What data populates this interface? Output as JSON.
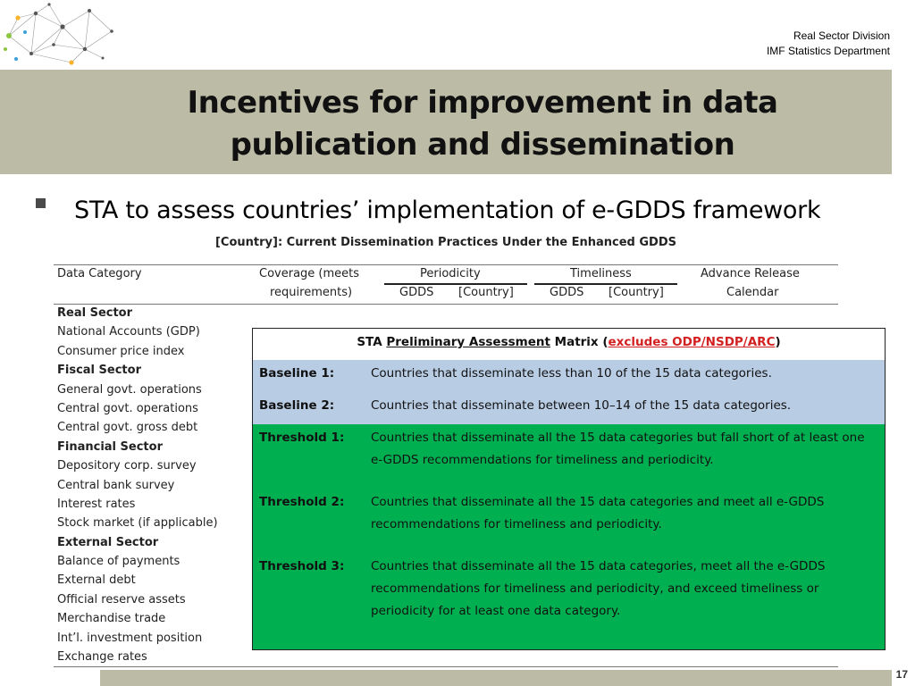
{
  "header": {
    "org_line1": "Real Sector Division",
    "org_line2": "IMF Statistics Department",
    "title_line1": "Incentives for improvement in data",
    "title_line2": "publication and dissemination"
  },
  "bullet": {
    "text": "STA to assess countries’ implementation of e-GDDS framework"
  },
  "table": {
    "title": "[Country]: Current Dissemination Practices Under the Enhanced GDDS",
    "headers": {
      "data_category": "Data Category",
      "coverage_1": "Coverage (meets",
      "coverage_2": "requirements)",
      "periodicity": "Periodicity",
      "timeliness": "Timeliness",
      "advance_1": "Advance Release",
      "advance_2": "Calendar",
      "gdds": "GDDS",
      "country": "[Country]"
    },
    "rows": [
      {
        "label": "Real Sector",
        "section": true
      },
      {
        "label": "National Accounts (GDP)",
        "section": false
      },
      {
        "label": "Consumer price index",
        "section": false
      },
      {
        "label": "Fiscal Sector",
        "section": true
      },
      {
        "label": "General govt. operations",
        "section": false
      },
      {
        "label": "Central govt. operations",
        "section": false
      },
      {
        "label": "Central govt. gross debt",
        "section": false
      },
      {
        "label": "Financial Sector",
        "section": true
      },
      {
        "label": "Depository corp. survey",
        "section": false
      },
      {
        "label": "Central bank survey",
        "section": false
      },
      {
        "label": "Interest rates",
        "section": false
      },
      {
        "label": "Stock market (if applicable)",
        "section": false
      },
      {
        "label": "External Sector",
        "section": true
      },
      {
        "label": "Balance of payments",
        "section": false
      },
      {
        "label": "External debt",
        "section": false
      },
      {
        "label": "Official reserve assets",
        "section": false
      },
      {
        "label": "Merchandise trade",
        "section": false
      },
      {
        "label": "Int’l. investment position",
        "section": false
      },
      {
        "label": "Exchange rates",
        "section": false
      }
    ]
  },
  "matrix": {
    "title_prefix": "STA ",
    "title_underlined": "Preliminary Assessment",
    "title_mid": " Matrix (",
    "title_red": "excludes ODP/NSDP/ARC",
    "title_suffix": ")",
    "colors": {
      "blue": "#b8cce4",
      "green": "#00b050",
      "red": "#d32020"
    },
    "items": [
      {
        "label": "Baseline 1:",
        "text": "Countries that disseminate less than 10 of the 15 data categories."
      },
      {
        "label": "Baseline 2:",
        "text": "Countries that disseminate between 10–14 of the 15 data categories."
      },
      {
        "label": "Threshold 1:",
        "text": "Countries that disseminate all the 15 data categories but fall short of at least one e-GDDS recommendations for timeliness and periodicity."
      },
      {
        "label": "Threshold 2:",
        "text": "Countries that disseminate all the 15 data categories and meet all e-GDDS recommendations for timeliness and periodicity."
      },
      {
        "label": "Threshold 3:",
        "text": "Countries that disseminate all the 15 data categories, meet all the e-GDDS recommendations for timeliness and periodicity, and exceed timeliness or periodicity for at least one data category."
      }
    ]
  },
  "footer": {
    "page_number": "17"
  }
}
